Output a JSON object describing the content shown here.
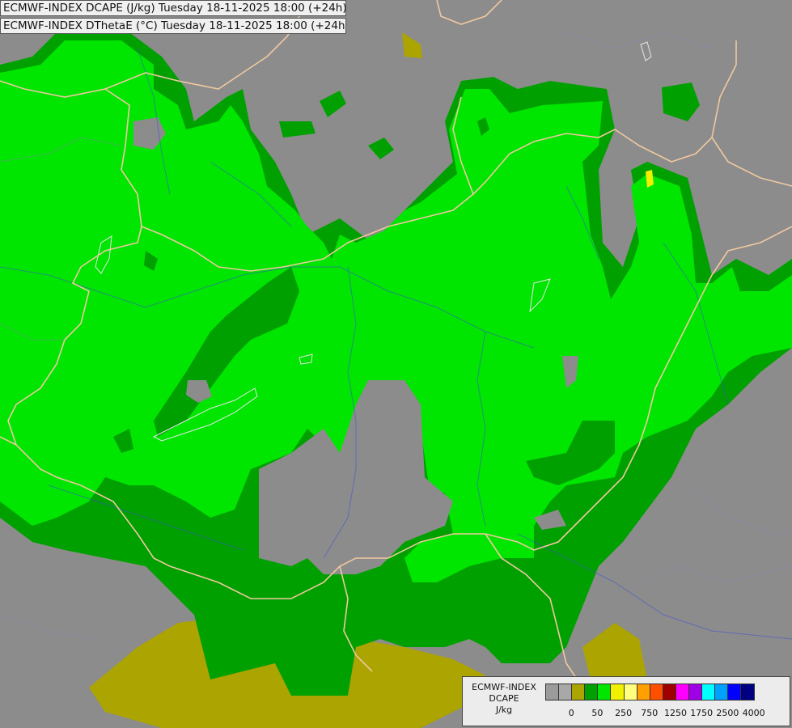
{
  "titles": {
    "line1": "ECMWF-INDEX DCAPE (J/kg) Tuesday 18-11-2025 18:00 (+24h)",
    "line2": "ECMWF-INDEX DThetaE (°C) Tuesday 18-11-2025 18:00 (+24h)"
  },
  "legend": {
    "source": "ECMWF-INDEX",
    "variable": "DCAPE",
    "unit": "J/kg",
    "colors": [
      "#9b9b9b",
      "#a8a8a8",
      "#aca400",
      "#00a000",
      "#00e600",
      "#f0f000",
      "#ffff80",
      "#ffa000",
      "#ff5000",
      "#a00000",
      "#ff00ff",
      "#a000e6",
      "#00ffff",
      "#00a0ff",
      "#0000ff",
      "#000080"
    ],
    "tick_labels": [
      "0",
      "50",
      "250",
      "750",
      "1250",
      "1750",
      "2500",
      "4000"
    ]
  },
  "map": {
    "background": "#8c8c8c",
    "border_color": "#f0c8a0",
    "river_color": "#3c50d2",
    "lake_color": "#e6e6e6"
  }
}
